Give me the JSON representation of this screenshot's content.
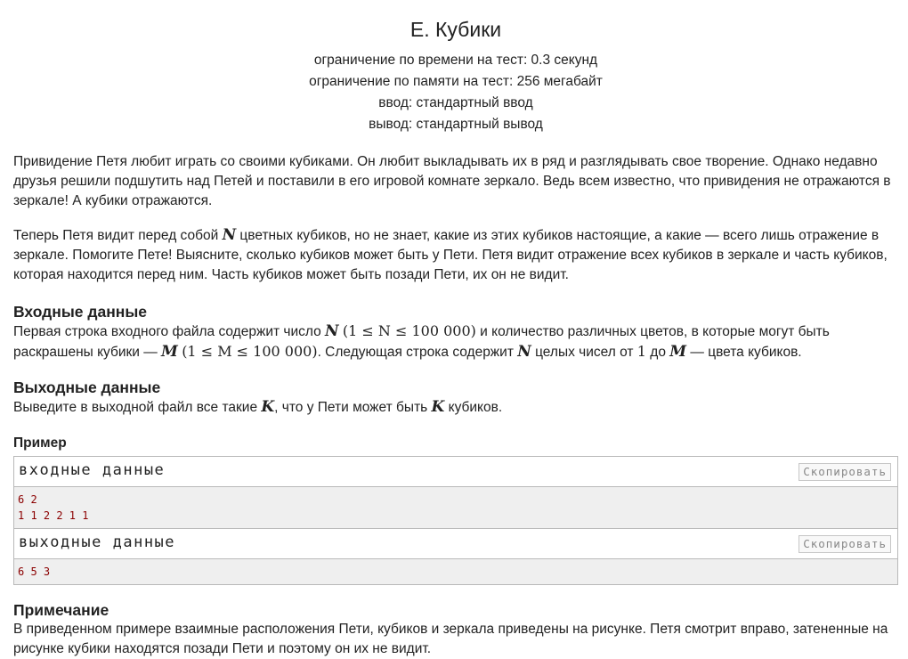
{
  "problem": {
    "title": "E. Кубики",
    "limits": [
      "ограничение по времени на тест: 0.3 секунд",
      "ограничение по памяти на тест: 256 мегабайт",
      "ввод: стандартный ввод",
      "вывод: стандартный вывод"
    ]
  },
  "statement": {
    "p1": "Привидение Петя любит играть со своими кубиками. Он любит выкладывать их в ряд и разглядывать свое творение. Однако недавно друзья решили подшутить над Петей и поставили в его игровой комнате зеркало. Ведь всем известно, что привидения не отражаются в зеркале! А кубики отражаются.",
    "p2_a": "Теперь Петя видит перед собой ",
    "p2_var": "N",
    "p2_b": " цветных кубиков, но не знает, какие из этих кубиков настоящие, а какие — всего лишь отражение в зеркале. Помогите Пете! Выясните, сколько кубиков может быть у Пети. Петя видит отражение всех кубиков в зеркале и часть кубиков, которая находится перед ним. Часть кубиков может быть позади Пети, их он не видит."
  },
  "input_section": {
    "title": "Входные данные",
    "t1": "Первая строка входного файла содержит число ",
    "var_n": "N",
    "range_n": "(1 ≤ N ≤ 100 000)",
    "t2": " и количество различных цветов, в которые могут быть раскрашены кубики — ",
    "var_m": "M",
    "range_m": "(1 ≤ M ≤ 100 000)",
    "t3": ". Следующая строка содержит ",
    "t4": " целых чисел от ",
    "num_one": "1",
    "t5": " до ",
    "t6": " — цвета кубиков."
  },
  "output_section": {
    "title": "Выходные данные",
    "t1": "Выведите в выходной файл все такие ",
    "var_k": "K",
    "t2": ", что у Пети может быть ",
    "t3": " кубиков."
  },
  "example": {
    "title": "Пример",
    "input_label": "входные данные",
    "input_copy": "Скопировать",
    "input_lines": [
      "6 2",
      "1 1 2 2 1 1"
    ],
    "output_label": "выходные данные",
    "output_copy": "Скопировать",
    "output_lines": [
      "6 5 3"
    ]
  },
  "note": {
    "title": "Примечание",
    "text": "В приведенном примере взаимные расположения Пети, кубиков и зеркала приведены на рисунке. Петя смотрит вправо, затененные на рисунке кубики находятся позади Пети и поэтому он их не видит."
  }
}
